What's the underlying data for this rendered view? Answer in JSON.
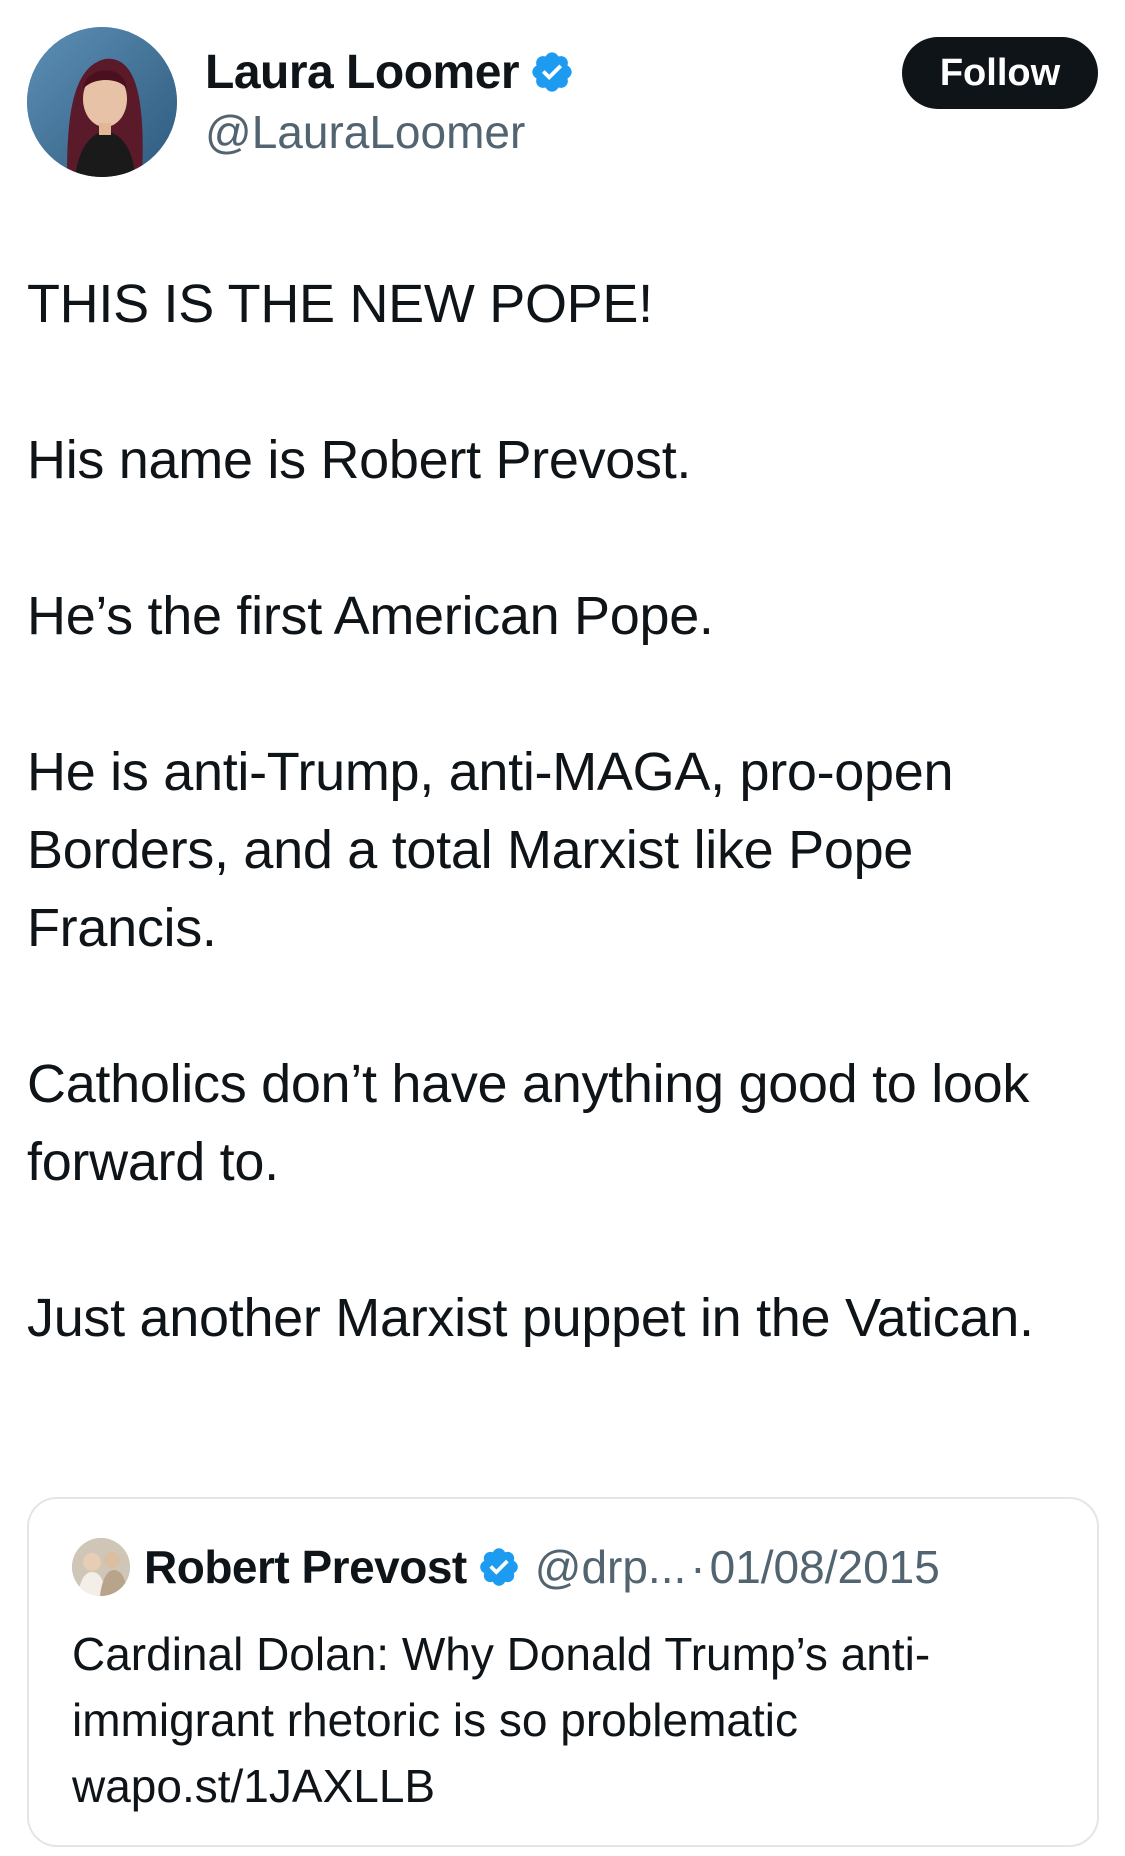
{
  "author": {
    "display_name": "Laura Loomer",
    "handle": "@LauraLoomer",
    "verified": true,
    "avatar_icon": "profile-photo-icon"
  },
  "follow_button": {
    "label": "Follow"
  },
  "tweet": {
    "paragraphs": [
      "THIS IS THE NEW POPE!",
      "His name is Robert Prevost.",
      "He’s the first American Pope.",
      "He is anti-Trump, anti-MAGA, pro-open Borders, and a total Marxist like Pope Francis.",
      "Catholics don’t have anything good to look forward to.",
      "Just another Marxist puppet in the Vatican."
    ]
  },
  "quoted_tweet": {
    "display_name": "Robert Prevost",
    "handle": "@drp...",
    "separator": "·",
    "date": "01/08/2015",
    "verified": true,
    "text": "Cardinal Dolan: Why Donald Trump’s anti-immigrant rhetoric is so problematic",
    "link": "wapo.st/1JAXLLB"
  },
  "colors": {
    "text_primary": "#0f1419",
    "text_secondary": "#536471",
    "verified_blue": "#1d9bf0",
    "button_bg": "#0f1419",
    "border": "#e1e6ea"
  }
}
